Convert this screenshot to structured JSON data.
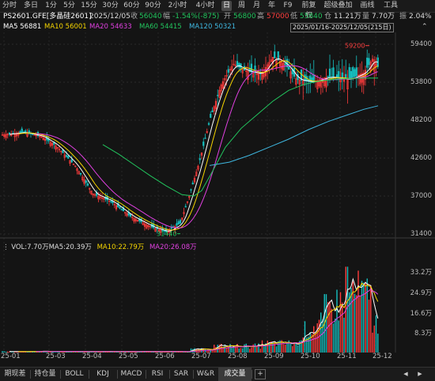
{
  "toolbar": {
    "items": [
      "分时",
      "多日",
      "1分",
      "5分",
      "15分",
      "30分",
      "60分",
      "90分",
      "2小时",
      "4小时",
      "日",
      "周",
      "月",
      "年",
      "F9",
      "前复权",
      "超级叠加",
      "画线",
      "工具"
    ],
    "active": "日"
  },
  "quote": {
    "code": "PS2601.GFE[多晶硅2601]",
    "date": "2025/12/05",
    "close_label": "收",
    "close": "56040",
    "change_label": "幅",
    "change": "-1.54%(-875)",
    "open_label": "开",
    "open": "56800",
    "high_label": "高",
    "high": "57000",
    "low_label": "低",
    "low": "55840",
    "oi_label": "仓",
    "oi": "11.21万",
    "vol_label": "量",
    "vol": "7.70万",
    "amp_label": "振",
    "amp": "2.04%"
  },
  "ma": {
    "ma5": "MA5 56881",
    "ma10": "MA10 56001",
    "ma20": "MA20 54633",
    "ma60": "MA60 54415",
    "ma120": "MA120 50321",
    "range": "2025/01/16-2025/12/05(215日)",
    "colors": {
      "ma5": "#ffffff",
      "ma10": "#f5d400",
      "ma20": "#e040e0",
      "ma60": "#22c55e",
      "ma120": "#3fb7e0"
    }
  },
  "volume_legend": {
    "vol": "VOL:7.70万",
    "ma5": "MA5:20.39万",
    "ma10": "MA10:22.79万",
    "ma20": "MA20:26.08万"
  },
  "annotations": {
    "high_marker": "59200",
    "low_marker": "31440"
  },
  "bottom_tabs": {
    "items": [
      "期现差",
      "持仓量",
      "BOLL",
      "KDJ",
      "MACD",
      "RSI",
      "SAR",
      "W&R",
      "成交量"
    ],
    "active": "成交量",
    "add": "+",
    "arrow_left": "◀",
    "arrow_right": "▶"
  },
  "chart_data": [
    {
      "type": "candlestick",
      "title": "",
      "y_ticks": [
        "59400",
        "53800",
        "48200",
        "42600",
        "37000",
        "31400"
      ],
      "x_ticks": [
        "25-01",
        "25-03",
        "25-04",
        "25-05",
        "25-06",
        "25-07",
        "25-08",
        "25-09",
        "25-10",
        "25-11",
        "25-12"
      ],
      "ylim": [
        30000,
        60500
      ],
      "close_path": [
        [
          "25-01",
          46000
        ],
        [
          "25-02",
          46500
        ],
        [
          "25-03",
          45500
        ],
        [
          "25-04",
          42600
        ],
        [
          "25-05",
          36000
        ],
        [
          "25-06",
          33000
        ],
        [
          "25-06-end",
          31440
        ],
        [
          "25-07",
          40000
        ],
        [
          "25-07-end",
          52000
        ],
        [
          "25-08",
          55500
        ],
        [
          "25-09",
          54500
        ],
        [
          "25-10",
          53000
        ],
        [
          "25-11",
          54000
        ],
        [
          "25-12",
          56040
        ]
      ],
      "ma60_path": [
        [
          "25-03",
          44000
        ],
        [
          "25-05",
          38000
        ],
        [
          "25-07",
          40500
        ],
        [
          "25-08",
          46000
        ],
        [
          "25-09",
          50500
        ],
        [
          "25-10",
          53500
        ],
        [
          "25-11",
          55500
        ],
        [
          "25-12",
          54415
        ]
      ],
      "ma120_path": [
        [
          "25-07",
          45000
        ],
        [
          "25-08",
          46000
        ],
        [
          "25-09",
          47500
        ],
        [
          "25-10",
          48800
        ],
        [
          "25-11",
          49800
        ],
        [
          "25-12",
          50321
        ]
      ],
      "high": 59200,
      "low": 31440,
      "up_color": "#ff3b3b",
      "down_color": "#16c0c0"
    },
    {
      "type": "bar",
      "title": "",
      "y_ticks": [
        "33.2万",
        "24.9万",
        "16.6万",
        "8.3万"
      ],
      "ylim": [
        0,
        36
      ],
      "ma5_last": 20.39,
      "ma10_last": 22.79,
      "ma20_last": 26.08,
      "last_volume": 7.7
    }
  ]
}
